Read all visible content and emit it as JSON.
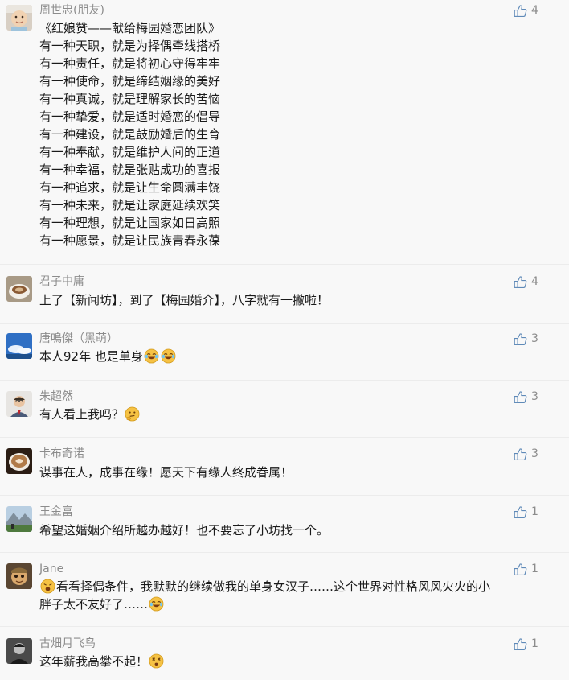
{
  "comments": [
    {
      "author": "周世忠(朋友)",
      "likes": "4",
      "avatar": "child-photo-avatar",
      "lines": [
        "《红娘赞——献给梅园婚恋团队》",
        "有一种天职，就是为择偶牵线搭桥",
        "有一种责任，就是将初心守得牢牢",
        "有一种使命，就是缔结姻缘的美好",
        "有一种真诚，就是理解家长的苦恼",
        "有一种挚爱，就是适时婚恋的倡导",
        "有一种建设，就是鼓励婚后的生育",
        "有一种奉献，就是维护人间的正道",
        "有一种幸福，就是张贴成功的喜报",
        "有一种追求，就是让生命圆满丰饶",
        "有一种未来，就是让家庭延续欢笑",
        "有一种理想，就是让国家如日高照",
        "有一种愿景，就是让民族青春永葆"
      ]
    },
    {
      "author": "君子中庸",
      "likes": "4",
      "avatar": "coffee-cup-avatar",
      "text": "上了【新闻坊】，到了【梅园婚介】，八字就有一撇啦！"
    },
    {
      "author": "唐鳴傑（黑萌）",
      "likes": "3",
      "avatar": "sky-clouds-avatar",
      "text": "本人92年 也是单身",
      "emoji": [
        "crying-laugh-emoji",
        "crying-laugh-emoji"
      ]
    },
    {
      "author": "朱超然",
      "likes": "3",
      "avatar": "man-portrait-avatar",
      "text": "有人看上我吗？",
      "emoji": [
        "thinking-emoji"
      ]
    },
    {
      "author": "卡布奇诺",
      "likes": "3",
      "avatar": "cappuccino-avatar",
      "text": "谋事在人，成事在缘！愿天下有缘人终成眷属！"
    },
    {
      "author": "王金富",
      "likes": "1",
      "avatar": "mountain-landscape-avatar",
      "text": "希望这婚姻介绍所越办越好！也不要忘了小坊找一个。"
    },
    {
      "author": "Jane",
      "likes": "1",
      "avatar": "anime-character-avatar",
      "text_line1": "看看择偶条件，我默默的继续做我的单身女汉子……这个世界对性格风风火火的小",
      "text_line2": "胖子太不友好了……",
      "emoji_start": "weary-face-emoji",
      "emoji_end": "crying-laugh-emoji"
    },
    {
      "author": "古畑月飞鸟",
      "likes": "1",
      "avatar": "dark-portrait-avatar",
      "text": "这年薪我高攀不起！",
      "emoji": [
        "dizzy-face-emoji"
      ]
    }
  ]
}
